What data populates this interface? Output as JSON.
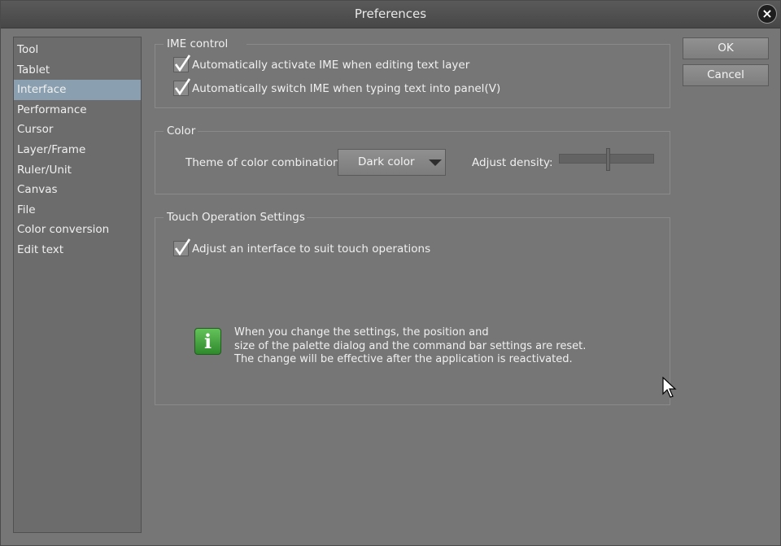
{
  "window": {
    "title": "Preferences"
  },
  "sidebar": {
    "items": [
      {
        "label": "Tool"
      },
      {
        "label": "Tablet"
      },
      {
        "label": "Interface"
      },
      {
        "label": "Performance"
      },
      {
        "label": "Cursor"
      },
      {
        "label": "Layer/Frame"
      },
      {
        "label": "Ruler/Unit"
      },
      {
        "label": "Canvas"
      },
      {
        "label": "File"
      },
      {
        "label": "Color conversion"
      },
      {
        "label": "Edit text"
      }
    ],
    "selected": "Interface"
  },
  "ime": {
    "title": "IME control",
    "options": [
      {
        "label": "Automatically activate IME when editing text layer",
        "checked": true
      },
      {
        "label": "Automatically switch IME when typing text into panel(V)",
        "checked": true
      }
    ]
  },
  "color": {
    "title": "Color",
    "theme_label": "Theme of color combination:",
    "theme_value": "Dark color",
    "density_label": "Adjust density:"
  },
  "touch": {
    "title": "Touch Operation Settings",
    "option": {
      "label": "Adjust an interface to suit touch operations",
      "checked": true
    },
    "info": {
      "line1": "When you change the settings, the position and",
      "line2": "size of the palette dialog and the command bar settings are reset.",
      "line3": "The change will be effective after the application is reactivated."
    }
  },
  "buttons": {
    "ok": "OK",
    "cancel": "Cancel"
  },
  "colors": {
    "background": "#767676",
    "selection": "#8aa0b0",
    "info_green": "#3fa53a"
  }
}
